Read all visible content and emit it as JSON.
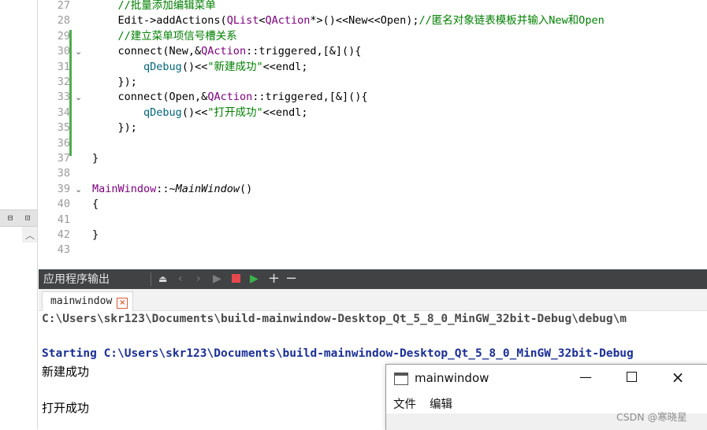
{
  "editor": {
    "lines": [
      {
        "num": "27",
        "fold": "",
        "segs": [
          {
            "t": "    ",
            "c": ""
          },
          {
            "t": "//批量添加编辑菜单",
            "c": "c-comment"
          }
        ]
      },
      {
        "num": "28",
        "fold": "",
        "segs": [
          {
            "t": "    Edit->addActions(",
            "c": ""
          },
          {
            "t": "QList",
            "c": "c-type"
          },
          {
            "t": "<",
            "c": ""
          },
          {
            "t": "QAction",
            "c": "c-type"
          },
          {
            "t": "*>()<<New<<Open);",
            "c": ""
          },
          {
            "t": "//匿名对象链表模板并输入New和Open",
            "c": "c-comment"
          }
        ]
      },
      {
        "num": "29",
        "fold": "",
        "segs": [
          {
            "t": "    ",
            "c": ""
          },
          {
            "t": "//建立菜单项信号槽关系",
            "c": "c-comment"
          }
        ]
      },
      {
        "num": "30",
        "fold": "⌄",
        "segs": [
          {
            "t": "    connect(New,&",
            "c": ""
          },
          {
            "t": "QAction",
            "c": "c-type"
          },
          {
            "t": "::triggered,[&](){",
            "c": ""
          }
        ]
      },
      {
        "num": "31",
        "fold": "",
        "segs": [
          {
            "t": "        ",
            "c": ""
          },
          {
            "t": "qDebug",
            "c": "c-fn"
          },
          {
            "t": "()<<",
            "c": ""
          },
          {
            "t": "\"新建成功\"",
            "c": "c-str"
          },
          {
            "t": "<<endl;",
            "c": ""
          }
        ]
      },
      {
        "num": "32",
        "fold": "",
        "segs": [
          {
            "t": "    });",
            "c": ""
          }
        ]
      },
      {
        "num": "33",
        "fold": "⌄",
        "segs": [
          {
            "t": "    connect(Open,&",
            "c": ""
          },
          {
            "t": "QAction",
            "c": "c-type"
          },
          {
            "t": "::triggered,[&](){",
            "c": ""
          }
        ]
      },
      {
        "num": "34",
        "fold": "",
        "segs": [
          {
            "t": "        ",
            "c": ""
          },
          {
            "t": "qDebug",
            "c": "c-fn"
          },
          {
            "t": "()<<",
            "c": ""
          },
          {
            "t": "\"打开成功\"",
            "c": "c-str"
          },
          {
            "t": "<<endl;",
            "c": ""
          }
        ]
      },
      {
        "num": "35",
        "fold": "",
        "segs": [
          {
            "t": "    });",
            "c": ""
          }
        ]
      },
      {
        "num": "36",
        "fold": "",
        "segs": []
      },
      {
        "num": "37",
        "fold": "",
        "segs": [
          {
            "t": "}",
            "c": ""
          }
        ]
      },
      {
        "num": "38",
        "fold": "",
        "segs": []
      },
      {
        "num": "39",
        "fold": "⌄",
        "segs": [
          {
            "t": "MainWindow",
            "c": "c-type"
          },
          {
            "t": "::~",
            "c": ""
          },
          {
            "t": "MainWindow",
            "c": "c-it"
          },
          {
            "t": "()",
            "c": ""
          }
        ]
      },
      {
        "num": "40",
        "fold": "",
        "segs": [
          {
            "t": "{",
            "c": ""
          }
        ]
      },
      {
        "num": "41",
        "fold": "",
        "segs": []
      },
      {
        "num": "42",
        "fold": "",
        "segs": [
          {
            "t": "}",
            "c": ""
          }
        ]
      },
      {
        "num": "43",
        "fold": "",
        "segs": []
      }
    ]
  },
  "output_panel": {
    "title": "应用程序输出",
    "tab_label": "mainwindow",
    "lines": [
      {
        "text": "C:\\Users\\skr123\\Documents\\build-mainwindow-Desktop_Qt_5_8_0_MinGW_32bit-Debug\\debug\\m",
        "style": "out-path"
      },
      {
        "text": "",
        "style": "out-msg"
      },
      {
        "text": "Starting C:\\Users\\skr123\\Documents\\build-mainwindow-Desktop_Qt_5_8_0_MinGW_32bit-Debug",
        "style": "out-start"
      },
      {
        "text": "新建成功",
        "style": "out-msg"
      },
      {
        "text": "",
        "style": "out-msg"
      },
      {
        "text": "打开成功",
        "style": "out-msg"
      }
    ]
  },
  "popup": {
    "title": "mainwindow",
    "menu": [
      "文件",
      "编辑"
    ]
  },
  "watermark": "CSDN @寒晓星",
  "colors": {
    "header_bg": "#404244",
    "stop_red": "#e5484d",
    "run_green": "#3bb34a",
    "change_bar": "#4cae4c"
  }
}
